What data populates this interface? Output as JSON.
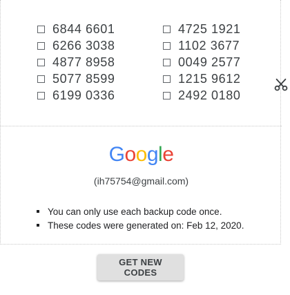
{
  "codes": {
    "left": [
      "6844 6601",
      "6266 3038",
      "4877 8958",
      "5077 8599",
      "6199 0336"
    ],
    "right": [
      "4725 1921",
      "1102 3677",
      "0049 2577",
      "1215 9612",
      "2492 0180"
    ]
  },
  "brand": {
    "letters": [
      "G",
      "o",
      "o",
      "g",
      "l",
      "e"
    ],
    "colors": [
      "#4285F4",
      "#EA4335",
      "#FBBC05",
      "#4285F4",
      "#34A853",
      "#EA4335"
    ]
  },
  "account": {
    "email": "(ih75754@gmail.com)"
  },
  "notes": [
    "You can only use each backup code once.",
    "These codes were generated on: Feb 12, 2020."
  ],
  "actions": {
    "get_new_codes": "GET NEW CODES"
  },
  "icons": {
    "scissors": "scissors-icon",
    "checkbox": "checkbox-icon"
  }
}
